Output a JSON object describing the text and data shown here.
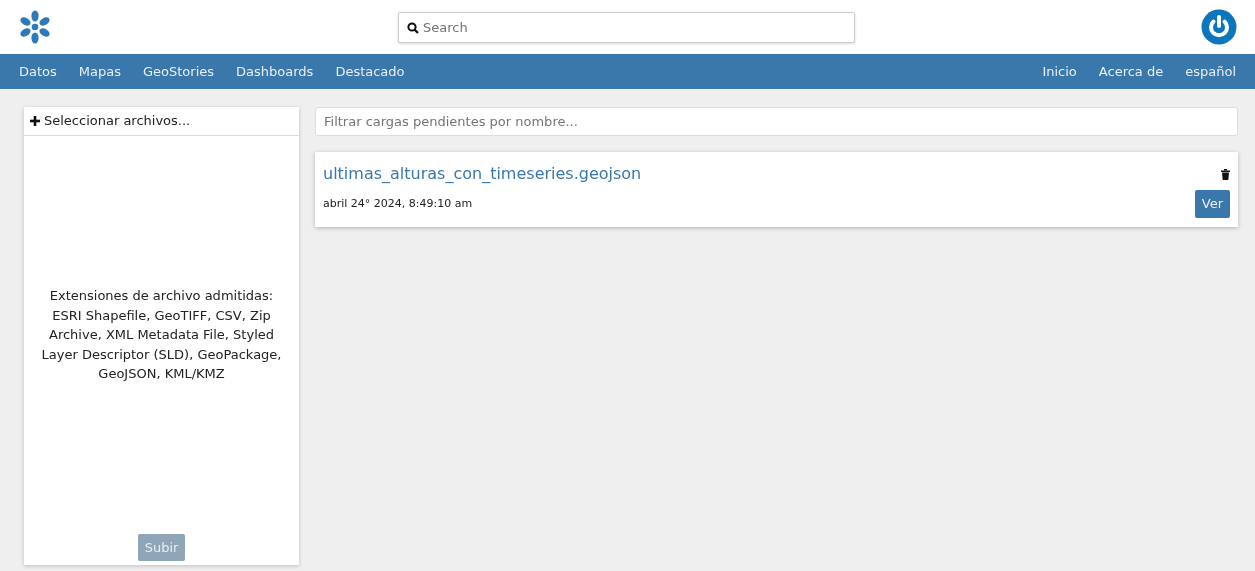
{
  "header": {
    "search": {
      "placeholder": "Search"
    }
  },
  "nav": {
    "left": [
      {
        "label": "Datos"
      },
      {
        "label": "Mapas"
      },
      {
        "label": "GeoStories"
      },
      {
        "label": "Dashboards"
      },
      {
        "label": "Destacado"
      }
    ],
    "right": [
      {
        "label": "Inicio"
      },
      {
        "label": "Acerca de"
      },
      {
        "label": "español"
      }
    ]
  },
  "upload_panel": {
    "select_label": "Seleccionar archivos...",
    "supported_text": "Extensiones de archivo admitidas: ESRI Shapefile, GeoTIFF, CSV, Zip Archive, XML Metadata File, Styled Layer Descriptor (SLD), GeoPackage, GeoJSON, KML/KMZ",
    "submit": {
      "label": "Subir",
      "disabled": true
    }
  },
  "filter": {
    "placeholder": "Filtrar cargas pendientes por nombre..."
  },
  "uploads": [
    {
      "name": "ultimas_alturas_con_timeseries.geojson",
      "date": "abril 24° 2024, 8:49:10 am",
      "button": "Ver"
    }
  ]
}
